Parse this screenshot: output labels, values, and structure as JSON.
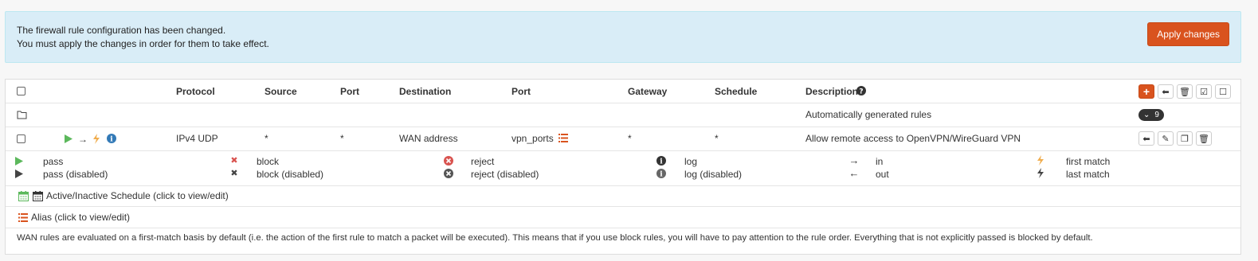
{
  "alert": {
    "line1": "The firewall rule configuration has been changed.",
    "line2": "You must apply the changes in order for them to take effect.",
    "apply_label": "Apply changes"
  },
  "table": {
    "headers": {
      "protocol": "Protocol",
      "source": "Source",
      "port": "Port",
      "destination": "Destination",
      "dest_port": "Port",
      "gateway": "Gateway",
      "schedule": "Schedule",
      "description": "Description"
    },
    "auto_row": {
      "description": "Automatically generated rules",
      "count": "9"
    },
    "rule_row": {
      "protocol": "IPv4 UDP",
      "source": "*",
      "port": "*",
      "destination": "WAN address",
      "dest_port": "vpn_ports",
      "gateway": "*",
      "schedule": "*",
      "description": "Allow remote access to OpenVPN/WireGuard VPN"
    }
  },
  "legend": {
    "pass": "pass",
    "pass_disabled": "pass (disabled)",
    "block": "block",
    "block_disabled": "block (disabled)",
    "reject": "reject",
    "reject_disabled": "reject (disabled)",
    "log": "log",
    "log_disabled": "log (disabled)",
    "in": "in",
    "out": "out",
    "first_match": "first match",
    "last_match": "last match",
    "schedule_note": "Active/Inactive Schedule (click to view/edit)",
    "alias_note": "Alias (click to view/edit)",
    "footer": "WAN rules are evaluated on a first-match basis by default (i.e. the action of the first rule to match a packet will be executed). This means that if you use block rules, you will have to pay attention to the rule order. Everything that is not explicitly passed is blocked by default."
  },
  "colors": {
    "accent": "#d9531e",
    "alert_bg": "#d9edf7",
    "pass_green": "#5cb85c",
    "block_red": "#d9534f"
  }
}
